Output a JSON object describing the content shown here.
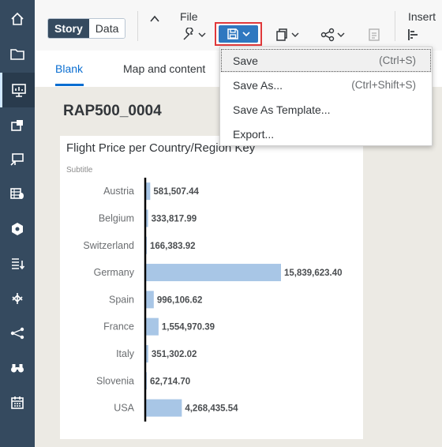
{
  "toolbar": {
    "story_label": "Story",
    "data_label": "Data",
    "file_label": "File",
    "insert_label": "Insert"
  },
  "tabs": [
    {
      "label": "Blank"
    },
    {
      "label": "Map and content"
    }
  ],
  "canvas": {
    "story_title": "RAP500_0004"
  },
  "save_menu": {
    "items": [
      {
        "label": "Save",
        "shortcut": "(Ctrl+S)"
      },
      {
        "label": "Save As...",
        "shortcut": "(Ctrl+Shift+S)"
      },
      {
        "label": "Save As Template...",
        "shortcut": ""
      },
      {
        "label": "Export...",
        "shortcut": ""
      }
    ]
  },
  "chart_data": {
    "type": "bar",
    "orientation": "horizontal",
    "title": "Flight Price per Country/Region Key",
    "subtitle": "Subtitle",
    "categories": [
      "Austria",
      "Belgium",
      "Switzerland",
      "Germany",
      "Spain",
      "France",
      "Italy",
      "Slovenia",
      "USA"
    ],
    "values": [
      581507.44,
      333817.99,
      166383.92,
      15839623.4,
      996106.62,
      1554970.39,
      351302.02,
      62714.7,
      4268435.54
    ],
    "value_labels": [
      "581,507.44",
      "333,817.99",
      "166,383.92",
      "15,839,623.40",
      "996,106.62",
      "1,554,970.39",
      "351,302.02",
      "62,714.70",
      "4,268,435.54"
    ],
    "bar_color": "#a8c6e6",
    "xlim": [
      0,
      15839623.4
    ]
  },
  "colors": {
    "shell": "#354a5f",
    "accent": "#0a6ed1",
    "highlight_border": "#e0383a"
  }
}
